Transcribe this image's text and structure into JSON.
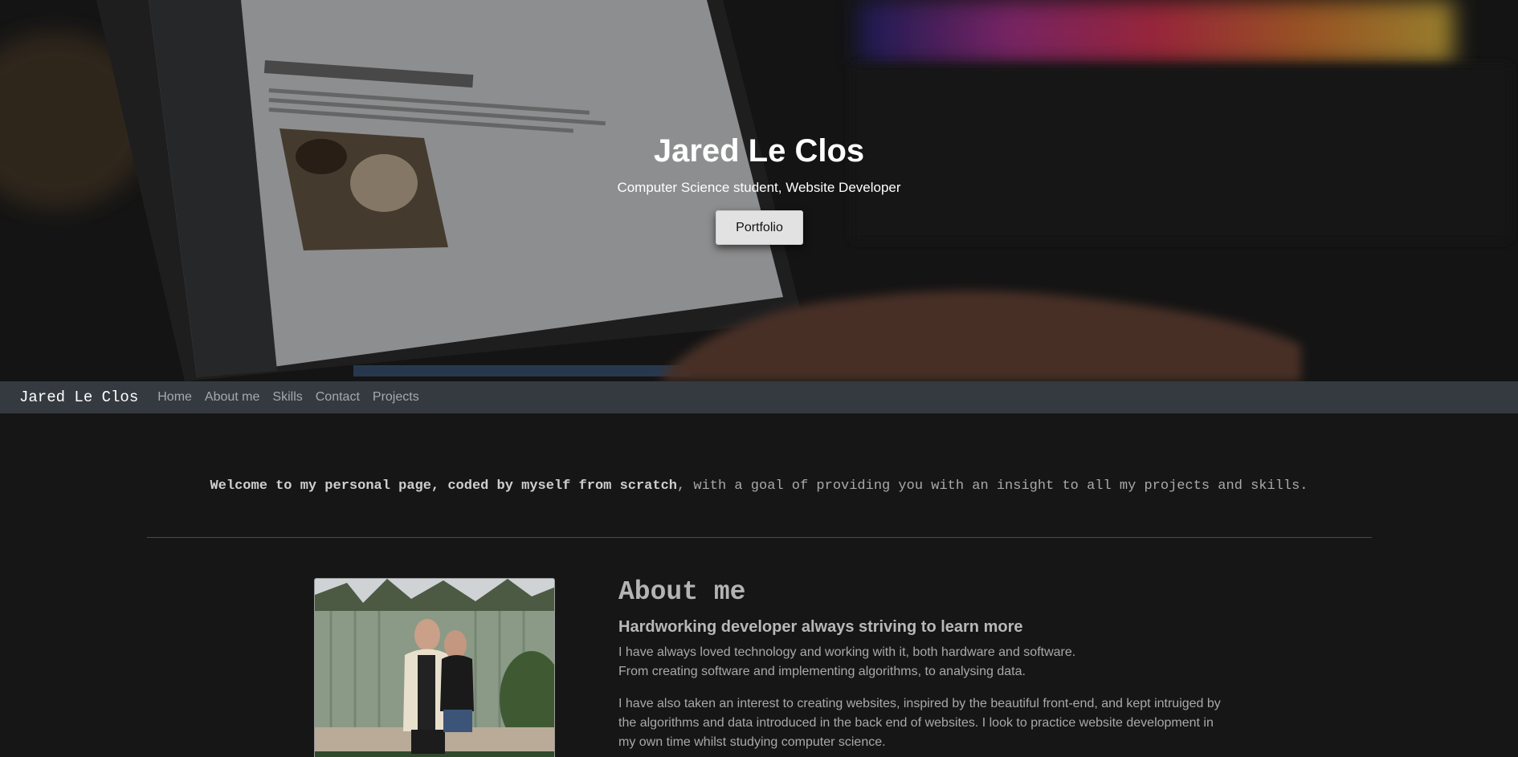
{
  "hero": {
    "title": "Jared Le Clos",
    "subtitle": "Computer Science student, Website Developer",
    "button_label": "Portfolio"
  },
  "nav": {
    "brand": "Jared Le Clos",
    "links": [
      "Home",
      "About me",
      "Skills",
      "Contact",
      "Projects"
    ]
  },
  "welcome": {
    "bold": "Welcome to my personal page, coded by myself from scratch",
    "rest": ", with a goal of providing you with an insight to all my projects and skills."
  },
  "about": {
    "title": "About me",
    "subtitle": "Hardworking developer always striving to learn more",
    "p1_line1": "I have always loved technology and working with it, both hardware and software.",
    "p1_line2": "From creating software and implementing algorithms, to analysing data.",
    "p2": "I have also taken an interest to creating websites, inspired by the beautiful front-end, and kept intruiged by the algorithms and data introduced in the back end of websites. I look to practice website development in my own time whilst studying computer science."
  },
  "colors": {
    "page_bg": "#161616",
    "navbar_bg": "#343a40",
    "button_bg": "#e2e2e2"
  }
}
